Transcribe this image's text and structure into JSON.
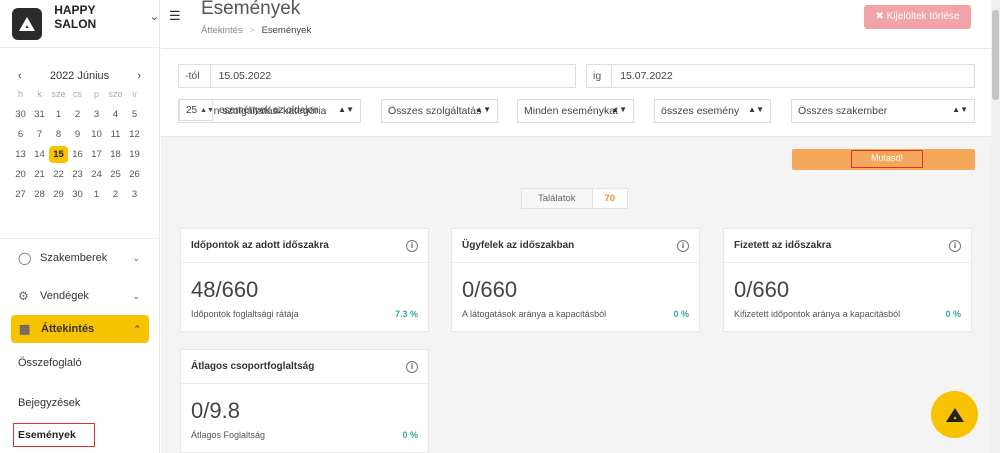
{
  "brand": {
    "name": "HAPPY SALON"
  },
  "calendar": {
    "month_label": "2022 Június",
    "weekdays": [
      "h",
      "k",
      "sze",
      "cs",
      "p",
      "szo",
      "v"
    ],
    "weeks": [
      [
        "30",
        "31",
        "1",
        "2",
        "3",
        "4",
        "5"
      ],
      [
        "6",
        "7",
        "8",
        "9",
        "10",
        "11",
        "12"
      ],
      [
        "13",
        "14",
        "15",
        "16",
        "17",
        "18",
        "19"
      ],
      [
        "20",
        "21",
        "22",
        "23",
        "24",
        "25",
        "26"
      ],
      [
        "27",
        "28",
        "29",
        "30",
        "1",
        "2",
        "3"
      ]
    ],
    "today": "15"
  },
  "menu": {
    "specialists": "Szakemberek",
    "guests": "Vendégek",
    "overview": "Áttekintés",
    "summary": "Összefoglaló",
    "entries": "Bejegyzések",
    "events": "Események"
  },
  "header": {
    "title": "Események",
    "crumb_root": "Áttekintés",
    "crumb_sep": ">",
    "crumb_current": "Események",
    "delete_label": "✖ Kijelöltek törlése"
  },
  "filters": {
    "from_prefix": "-tól",
    "from_value": "15.05.2022",
    "to_prefix": "ig",
    "to_value": "15.07.2022",
    "category": "Minden szolgáltatási kategória",
    "service": "Összes szolgáltatás",
    "event_type": "Minden eseménykat",
    "events": "összes esemény",
    "specialist": "Összes szakember",
    "per_page_value": "25",
    "per_page_label": "események az oldalon",
    "show_label": "Mutasd!"
  },
  "results": {
    "label": "Találatok",
    "count": "70"
  },
  "cards": [
    {
      "title": "Időpontok az adott időszakra",
      "value": "48/660",
      "caption": "Időpontok foglaltsági rátája",
      "pct": "7.3 %"
    },
    {
      "title": "Ügyfelek az időszakban",
      "value": "0/660",
      "caption": "A látogatások aránya a kapacitásból",
      "pct": "0 %"
    },
    {
      "title": "Fizetett az időszakra",
      "value": "0/660",
      "caption": "Kifizetett időpontok aránya a kapacitásból",
      "pct": "0 %"
    },
    {
      "title": "Átlagos csoportfoglaltság",
      "value": "0/9.8",
      "caption": "Átlagos Foglaltság",
      "pct": "0 %"
    }
  ],
  "colors": {
    "accent": "#f7c300",
    "orange": "#f6a85a",
    "danger": "#f2a3a8",
    "teal": "#3ba6a6"
  }
}
